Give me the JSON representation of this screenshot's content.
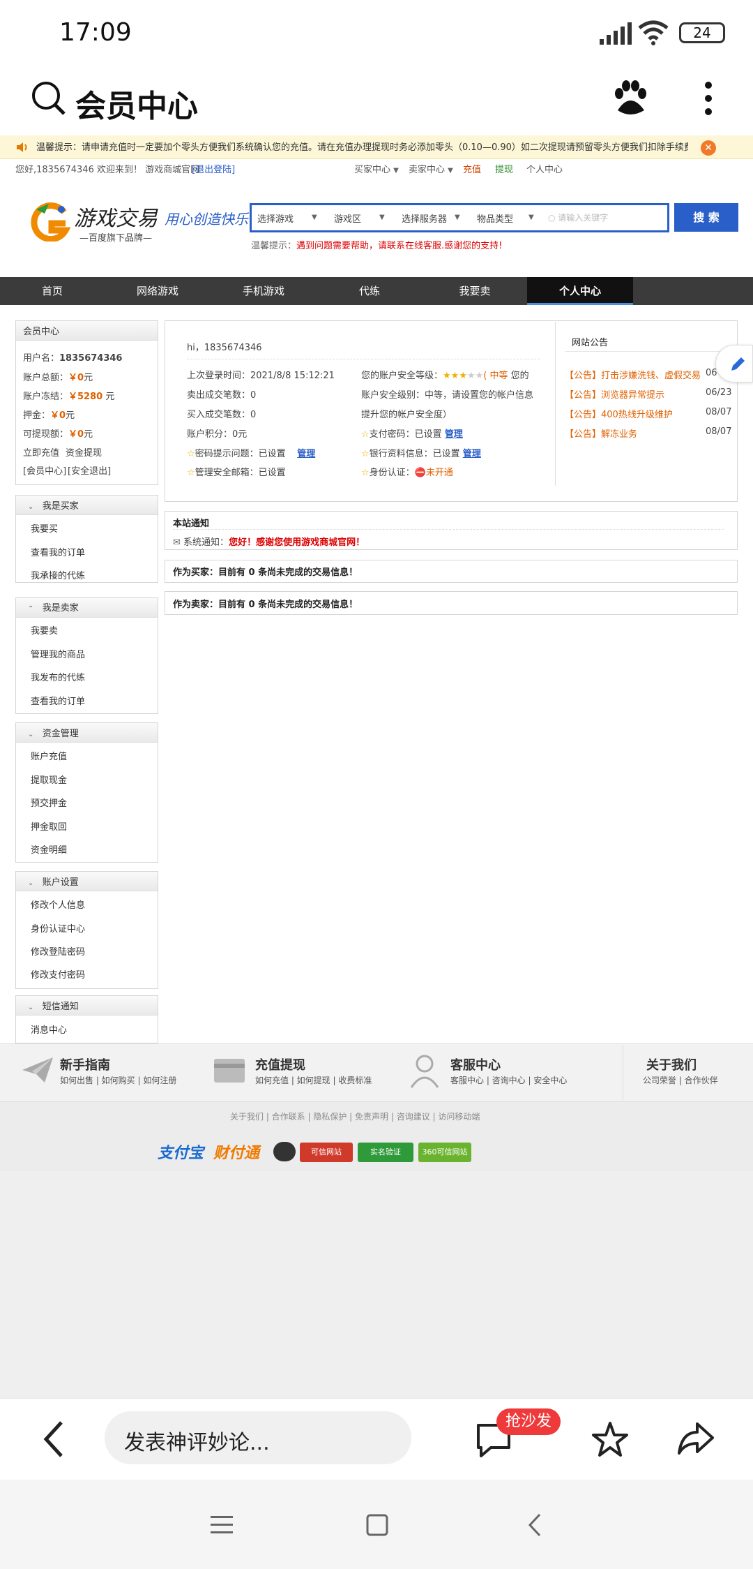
{
  "status_bar": {
    "time": "17:09",
    "battery": "24"
  },
  "app_bar": {
    "title": "会员中心"
  },
  "notice": {
    "text": "温馨提示：请申请充值时一定要加个零头方便我们系统确认您的充值。请在充值办理提现时务必添加零头（0.10—0.90）如二次提现请预留零头方便我们扣除手续费"
  },
  "top_links": {
    "greeting": "您好,1835674346 欢迎来到！ 游戏商城官网",
    "logout": "[退出登陆]",
    "buyer_center": "买家中心",
    "seller_center": "卖家中心",
    "recharge": "充值",
    "withdraw": "提现",
    "personal_center": "个人中心"
  },
  "logo": {
    "brand": "游戏交易",
    "slogan": "用心创造快乐",
    "sub": "—百度旗下品牌—"
  },
  "search": {
    "game": "选择游戏",
    "area": "游戏区",
    "server": "选择服务器",
    "item_type": "物品类型",
    "placeholder": "请输入关键字",
    "button": "搜 索",
    "tip_label": "温馨提示：",
    "tip_text": "遇到问题需要帮助，请联系在线客服.感谢您的支持!"
  },
  "nav": {
    "items": [
      "首页",
      "网络游戏",
      "手机游戏",
      "代练",
      "我要卖",
      "个人中心"
    ]
  },
  "sidebar": {
    "member": {
      "title": "会员中心",
      "username_label": "用户名：",
      "username": "1835674346",
      "total_label": "账户总额：",
      "total": "￥0",
      "total_unit": "元",
      "frozen_label": "账户冻结：",
      "frozen": "￥5280",
      "frozen_unit": "元",
      "deposit_label": "押金：",
      "deposit": "￥0",
      "deposit_unit": "元",
      "withdrawable_label": "可提现额：",
      "withdrawable": "￥0",
      "withdrawable_unit": "元",
      "recharge_link": "立即充值",
      "withdraw_link": "资金提现",
      "member_link": "[会员中心]",
      "security_link": "[安全退出]"
    },
    "buyer": {
      "title": "我是买家",
      "items": [
        "我要买",
        "查看我的订单",
        "我承接的代练"
      ]
    },
    "seller": {
      "title": "我是卖家",
      "items": [
        "我要卖",
        "管理我的商品",
        "我发布的代练",
        "查看我的订单"
      ]
    },
    "funds": {
      "title": "资金管理",
      "items": [
        "账户充值",
        "提取现金",
        "预交押金",
        "押金取回",
        "资金明细"
      ]
    },
    "account": {
      "title": "账户设置",
      "items": [
        "修改个人信息",
        "身份认证中心",
        "修改登陆密码",
        "修改支付密码"
      ]
    },
    "sms": {
      "title": "短信通知",
      "items": [
        "消息中心"
      ]
    }
  },
  "profile": {
    "hi": "hi，1835674346",
    "last_login_label": "上次登录时间：",
    "last_login": "2021/8/8 15:12:21",
    "sold_label": "卖出成交笔数：",
    "sold": "0",
    "bought_label": "买入成交笔数：",
    "bought": "0",
    "points_label": "账户积分：",
    "points": "0元",
    "pwd_q_label": "密码提示问题：",
    "pwd_q": "已设置",
    "manage": "管理",
    "email_label": "管理安全邮箱：",
    "email": "已设置",
    "level_label": "您的账户安全等级：",
    "level_text": "( 中等",
    "level_tail": " 您的",
    "level_line2": "账户安全级别：中等，请设置您的帐户信息",
    "level_line3": "提升您的帐户安全度）",
    "pay_pwd_label": "支付密码：",
    "pay_pwd": "已设置",
    "bank_label": "银行资料信息：",
    "bank": "已设置",
    "id_label": "身份认证：",
    "id_status": "未开通"
  },
  "announcements": {
    "title": "网站公告",
    "items": [
      {
        "tag": "【公告】",
        "text": "打击涉嫌洗钱、虚假交易",
        "date": "06/"
      },
      {
        "tag": "【公告】",
        "text": "浏览器异常提示",
        "date": "06/23"
      },
      {
        "tag": "【公告】",
        "text": "400热线升级维护",
        "date": "08/07"
      },
      {
        "tag": "【公告】",
        "text": "解冻业务",
        "date": "08/07"
      }
    ]
  },
  "site_notice": {
    "title": "本站通知",
    "label": "系统通知：",
    "text": "您好！感谢您使用游戏商城官网！"
  },
  "buyer_status": "作为买家：目前有 0 条尚未完成的交易信息！",
  "seller_status": "作为卖家：目前有 0 条尚未完成的交易信息！",
  "footer": {
    "guide": {
      "title": "新手指南",
      "links": "如何出售 | 如何购买 | 如何注册"
    },
    "recharge": {
      "title": "充值提现",
      "links": "如何充值 | 如何提现 | 收费标准"
    },
    "service": {
      "title": "客服中心",
      "links": "客服中心 | 咨询中心 | 安全中心"
    },
    "about": {
      "title": "关于我们",
      "links": "公司荣誉 | 合作伙伴"
    },
    "bottom_links": "关于我们 | 合作联系 | 隐私保护 | 免责声明 | 咨询建议 | 访问移动端",
    "badges": [
      "支付宝",
      "财付通",
      "可信网站",
      "实名验证",
      "360可信网站"
    ]
  },
  "bottom_bar": {
    "comment_placeholder": "发表神评妙论...",
    "sofa": "抢沙发"
  },
  "colors": {
    "accent": "#2a5ec8",
    "nav": "#3b3b3b",
    "red": "#dd0000",
    "orange": "#e06000"
  }
}
